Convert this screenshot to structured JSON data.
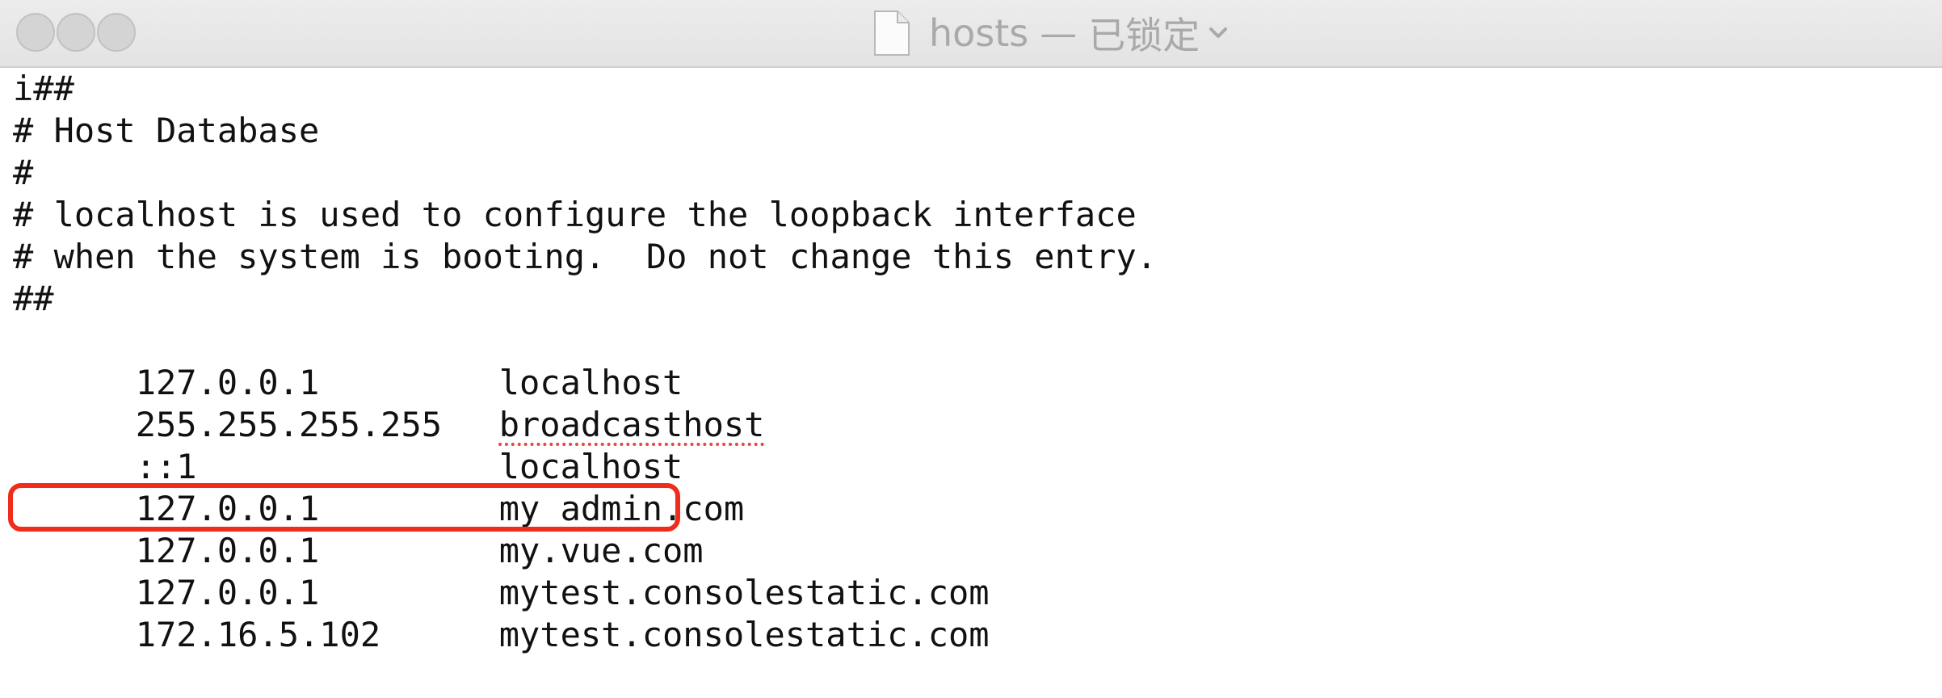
{
  "window": {
    "title": {
      "filename": "hosts",
      "separator": "—",
      "status": "已锁定"
    },
    "icons": {
      "close": "close-icon",
      "minimize": "minimize-icon",
      "zoom": "zoom-icon",
      "document": "document-icon",
      "chevron": "chevron-down-icon"
    }
  },
  "editor": {
    "comment_lines": [
      "i##",
      "# Host Database",
      "#",
      "# localhost is used to configure the loopback interface",
      "# when the system is booting.  Do not change this entry.",
      "##"
    ],
    "entries": [
      {
        "ip": "127.0.0.1",
        "host": "localhost"
      },
      {
        "ip": "255.255.255.255",
        "host": "broadcasthost"
      },
      {
        "ip": "::1",
        "host": "localhost"
      },
      {
        "ip": "127.0.0.1",
        "host": "my admin.com"
      },
      {
        "ip": "127.0.0.1",
        "host": "my.vue.com"
      },
      {
        "ip": "127.0.0.1",
        "host": "mytest.consolestatic.com"
      },
      {
        "ip": "172.16.5.102",
        "host": "mytest.consolestatic.com"
      }
    ]
  },
  "colors": {
    "highlight_box": "#f02d1a",
    "spellcheck_underline": "#e2483d",
    "title_text": "#a9a9a9"
  }
}
